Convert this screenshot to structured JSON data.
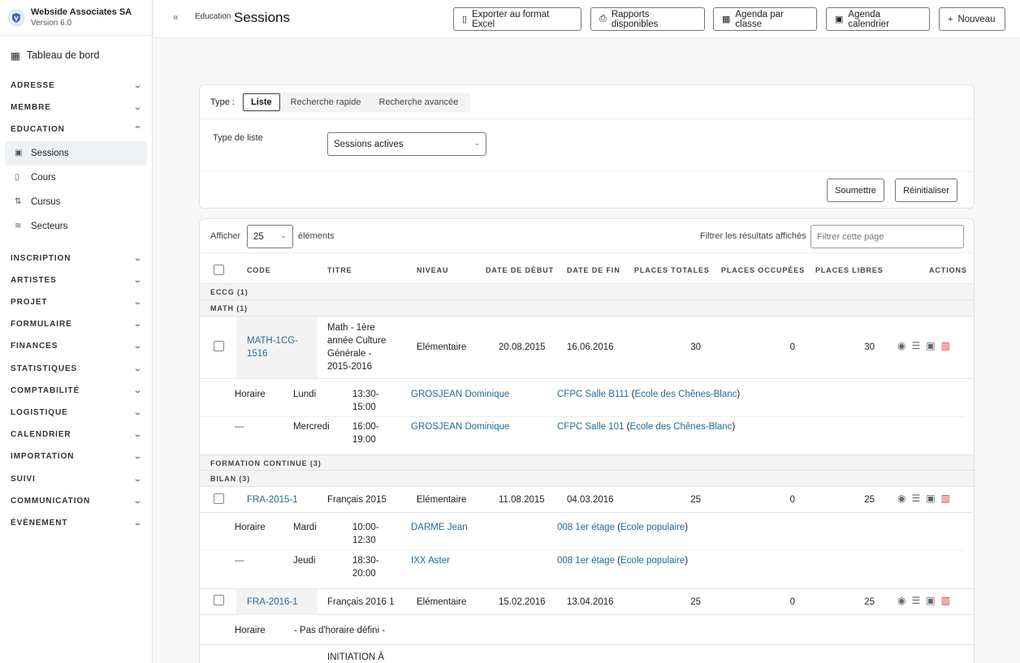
{
  "sidebar": {
    "brand_name": "Webside Associates SA",
    "brand_version": "Version 6.0",
    "dashboard": "Tableau de bord",
    "sections_top": [
      "ADRESSE",
      "MEMBRE",
      "EDUCATION"
    ],
    "education_items": [
      "Sessions",
      "Cours",
      "Cursus",
      "Secteurs"
    ],
    "sections_bottom": [
      "INSCRIPTION",
      "ARTISTES",
      "PROJET",
      "FORMULAIRE",
      "FINANCES",
      "STATISTIQUES",
      "COMPTABILITÉ",
      "LOGISTIQUE",
      "CALENDRIER",
      "IMPORTATION",
      "SUIVI",
      "COMMUNICATION",
      "ÉVÈNEMENT"
    ]
  },
  "header": {
    "breadcrumb": "Education",
    "title": "Sessions",
    "buttons": [
      "Exporter au format Excel",
      "Rapports disponibles",
      "Agenda par classe",
      "Agenda calendrier",
      "Nouveau"
    ]
  },
  "filters": {
    "type_label": "Type :",
    "tabs": [
      "Liste",
      "Recherche rapide",
      "Recherche avancée"
    ],
    "list_type_label": "Type de liste",
    "list_type_value": "Sessions actives",
    "submit": "Soumettre",
    "reset": "Réinitialiser"
  },
  "table": {
    "show_label": "Afficher",
    "page_size": "25",
    "elements_label": "éléments",
    "filter_label": "Filtrer les résultats affichés",
    "filter_placeholder": "Filtrer cette page",
    "columns": [
      "CODE",
      "TITRE",
      "NIVEAU",
      "DATE DE DÉBUT",
      "DATE DE FIN",
      "PLACES TOTALES",
      "PLACES OCCUPÉES",
      "PLACES LIBRES",
      "ACTIONS"
    ],
    "groups": {
      "eccg": "ECCG (1)",
      "math": "MATH (1)",
      "fc": "FORMATION CONTINUE (3)",
      "bilan": "BILAN (3)"
    },
    "rows": [
      {
        "code": "MATH-1CG-1516",
        "title": "Math - 1ère année Culture Générale - 2015-2016",
        "level": "Elémentaire",
        "start": "20.08.2015",
        "end": "16.06.2016",
        "total": "30",
        "occupied": "0",
        "free": "30"
      },
      {
        "code": "FRA-2015-1",
        "title": "Français 2015",
        "level": "Elémentaire",
        "start": "11.08.2015",
        "end": "04.03.2016",
        "total": "25",
        "occupied": "0",
        "free": "25"
      },
      {
        "code": "FRA-2016-1",
        "title": "Français 2016 1",
        "level": "Elémentaire",
        "start": "15.02.2016",
        "end": "13.04.2016",
        "total": "25",
        "occupied": "0",
        "free": "25"
      }
    ],
    "schedule_label": "Horaire",
    "dash": "—",
    "schedules": [
      {
        "day": "Lundi",
        "time": "13:30-\n15:00",
        "teacher": "GROSJEAN Dominique",
        "room": "CFPC Salle B111",
        "school": "Ecole des Chênes-Blanc"
      },
      {
        "day": "Mercredi",
        "time": "16:00-\n19:00",
        "teacher": "GROSJEAN Dominique",
        "room": "CFPC Salle 101",
        "school": "Ecole des Chênes-Blanc"
      },
      {
        "day": "Mardi",
        "time": "10:00-\n12:30",
        "teacher": "DARME Jean",
        "room": "008 1er étage",
        "school": "Ecole populaire"
      },
      {
        "day": "Jeudi",
        "time": "18:30-\n20:00",
        "teacher": "IXX Aster",
        "room": "008 1er étage",
        "school": "Ecole populaire"
      }
    ],
    "no_schedule": "- Pas d'horaire défini -",
    "next_title": "INITIATION À"
  }
}
